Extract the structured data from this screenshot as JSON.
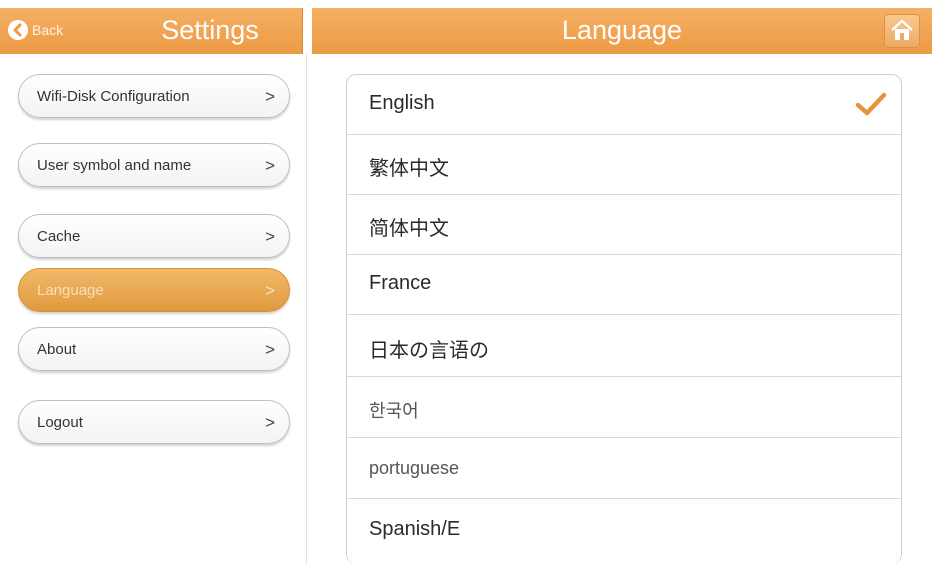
{
  "header": {
    "back_label": "Back",
    "settings_title": "Settings",
    "language_title": "Language",
    "accent_color": "#ec9a43"
  },
  "sidebar": {
    "items": [
      {
        "label": "Wifi-Disk Configuration",
        "chevron": ">"
      },
      {
        "label": "User symbol and name",
        "chevron": ">"
      },
      {
        "label": "Cache",
        "chevron": ">"
      },
      {
        "label": "Language",
        "chevron": ">",
        "selected": true
      },
      {
        "label": "About",
        "chevron": ">"
      },
      {
        "label": "Logout",
        "chevron": ">"
      }
    ]
  },
  "languages": {
    "selected": "English",
    "items": [
      {
        "label": "English"
      },
      {
        "label": "繁体中文"
      },
      {
        "label": "简体中文"
      },
      {
        "label": "France"
      },
      {
        "label": "日本の言语の"
      },
      {
        "label": "한국어"
      },
      {
        "label": "portuguese"
      },
      {
        "label": "Spanish/E"
      }
    ]
  },
  "icons": {
    "back": "back-arrow-icon",
    "home": "home-icon",
    "check": "checkmark-icon"
  }
}
